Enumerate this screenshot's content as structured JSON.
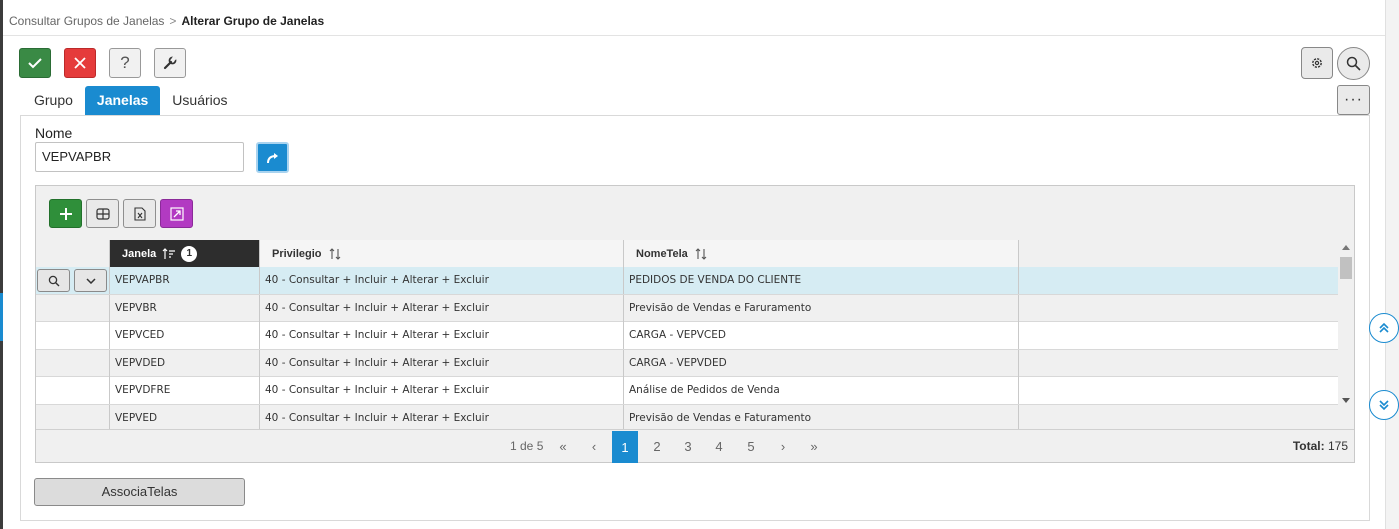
{
  "breadcrumb": {
    "parent": "Consultar Grupos de Janelas",
    "separator": ">",
    "current": "Alterar Grupo de Janelas"
  },
  "toolbar": {
    "help_label": "?",
    "more_label": "···"
  },
  "tabs": [
    {
      "label": "Grupo",
      "active": false
    },
    {
      "label": "Janelas",
      "active": true
    },
    {
      "label": "Usuários",
      "active": false
    }
  ],
  "form": {
    "nome_label": "Nome",
    "nome_value": "VEPVAPBR"
  },
  "grid": {
    "columns": [
      {
        "label": "Janela",
        "sort_order": "1"
      },
      {
        "label": "Privilegio"
      },
      {
        "label": "NomeTela"
      }
    ],
    "rows": [
      {
        "janela": "VEPVAPBR",
        "privilegio": "40 - Consultar + Incluir + Alterar + Excluir",
        "nometela": "PEDIDOS DE VENDA DO CLIENTE",
        "selected": true
      },
      {
        "janela": "VEPVBR",
        "privilegio": "40 - Consultar + Incluir + Alterar + Excluir",
        "nometela": "Previsão de Vendas e Faruramento"
      },
      {
        "janela": "VEPVCED",
        "privilegio": "40 - Consultar + Incluir + Alterar + Excluir",
        "nometela": "CARGA - VEPVCED"
      },
      {
        "janela": "VEPVDED",
        "privilegio": "40 - Consultar + Incluir + Alterar + Excluir",
        "nometela": "CARGA - VEPVDED"
      },
      {
        "janela": "VEPVDFRE",
        "privilegio": "40 - Consultar + Incluir + Alterar + Excluir",
        "nometela": "Análise de Pedidos de Venda"
      },
      {
        "janela": "VEPVED",
        "privilegio": "40 - Consultar + Incluir + Alterar + Excluir",
        "nometela": "Previsão de Vendas e Faturamento"
      }
    ]
  },
  "pager": {
    "info": "1 de 5",
    "first": "«",
    "prev": "‹",
    "pages": [
      "1",
      "2",
      "3",
      "4",
      "5"
    ],
    "next": "›",
    "last": "»",
    "total_label": "Total:",
    "total_value": "175"
  },
  "footer": {
    "associa_label": "AssociaTelas"
  },
  "colors": {
    "accent": "#1a8bd0",
    "ok": "#3a8a45",
    "cancel": "#e53b3b",
    "export": "#b23ac2"
  }
}
